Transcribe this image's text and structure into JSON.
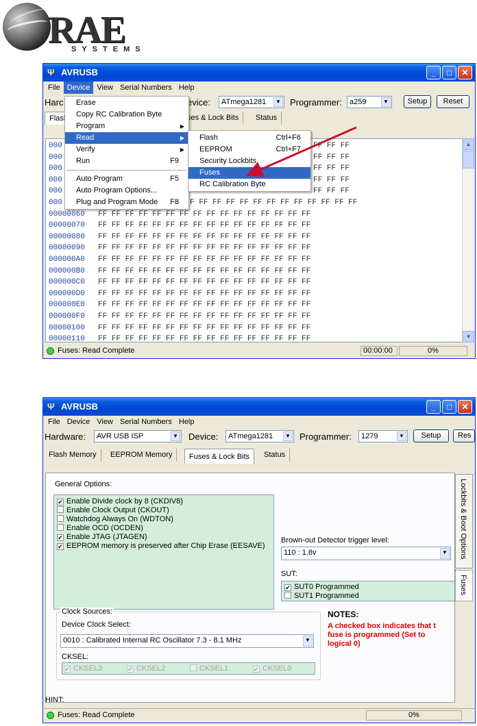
{
  "logo": {
    "text": "RAE",
    "sub": "SYSTEMS"
  },
  "window1": {
    "title": "AVRUSB",
    "menu": [
      "File",
      "Device",
      "View",
      "Serial Numbers",
      "Help"
    ],
    "toolbar": {
      "hardware_label": "Harc",
      "device_label": "evice:",
      "device_value": "ATmega1281",
      "programmer_label": "Programmer:",
      "programmer_value": "a259",
      "setup": "Setup",
      "reset": "Reset"
    },
    "tabs": [
      "Flasl",
      "ses & Lock Bits",
      "Status"
    ],
    "hex_rows_partial": [
      {
        "addr": "000",
        "bytes": "FF FF FF"
      },
      {
        "addr": "000",
        "bytes": "FF FF FF"
      },
      {
        "addr": "000",
        "bytes": "FF FF FF"
      },
      {
        "addr": "000",
        "bytes": "FF FF FF"
      },
      {
        "addr": "000",
        "bytes": "FF FF FF"
      },
      {
        "addr": "000",
        "bytes": "FF FF FF FF FF FF FF FF FF FF FF FF FF FF FF FF"
      },
      {
        "addr": "00000060",
        "bytes": "FF FF FF FF FF FF FF FF FF FF FF FF FF FF FF FF"
      }
    ],
    "hex_rows": [
      {
        "addr": "00000070",
        "bytes": "FF FF FF FF FF FF FF FF FF FF FF FF FF FF FF FF"
      },
      {
        "addr": "00000080",
        "bytes": "FF FF FF FF FF FF FF FF FF FF FF FF FF FF FF FF"
      },
      {
        "addr": "00000090",
        "bytes": "FF FF FF FF FF FF FF FF FF FF FF FF FF FF FF FF"
      },
      {
        "addr": "000000A0",
        "bytes": "FF FF FF FF FF FF FF FF FF FF FF FF FF FF FF FF"
      },
      {
        "addr": "000000B0",
        "bytes": "FF FF FF FF FF FF FF FF FF FF FF FF FF FF FF FF"
      },
      {
        "addr": "000000C0",
        "bytes": "FF FF FF FF FF FF FF FF FF FF FF FF FF FF FF FF"
      },
      {
        "addr": "000000D0",
        "bytes": "FF FF FF FF FF FF FF FF FF FF FF FF FF FF FF FF"
      },
      {
        "addr": "000000E0",
        "bytes": "FF FF FF FF FF FF FF FF FF FF FF FF FF FF FF FF"
      },
      {
        "addr": "000000F0",
        "bytes": "FF FF FF FF FF FF FF FF FF FF FF FF FF FF FF FF"
      },
      {
        "addr": "00000100",
        "bytes": "FF FF FF FF FF FF FF FF FF FF FF FF FF FF FF FF"
      },
      {
        "addr": "00000110",
        "bytes": "FF FF FF FF FF FF FF FF FF FF FF FF FF FF FF FF"
      }
    ],
    "device_menu": [
      {
        "label": "Erase",
        "shortcut": ""
      },
      {
        "label": "Copy RC Calibration Byte",
        "shortcut": ""
      },
      {
        "label": "Program",
        "shortcut": ""
      },
      {
        "label": "Read",
        "shortcut": ""
      },
      {
        "label": "Verify",
        "shortcut": ""
      },
      {
        "label": "Run",
        "shortcut": "F9"
      },
      {
        "label": "Auto Program",
        "shortcut": "F5"
      },
      {
        "label": "Auto Program Options...",
        "shortcut": ""
      },
      {
        "label": "Plug and Program Mode",
        "shortcut": "F8"
      }
    ],
    "read_submenu": [
      {
        "label": "Flash",
        "shortcut": "Ctrl+F6"
      },
      {
        "label": "EEPROM",
        "shortcut": "Ctrl+F7"
      },
      {
        "label": "Security Lockbits",
        "shortcut": ""
      },
      {
        "label": "Fuses",
        "shortcut": ""
      },
      {
        "label": "RC Calibration Byte",
        "shortcut": ""
      }
    ],
    "status": {
      "text": "Fuses: Read Complete",
      "time": "00:00:00",
      "percent": "0%"
    }
  },
  "window2": {
    "title": "AVRUSB",
    "menu": [
      "File",
      "Device",
      "View",
      "Serial Numbers",
      "Help"
    ],
    "toolbar": {
      "hardware_label": "Hardware:",
      "hardware_value": "AVR USB ISP",
      "device_label": "Device:",
      "device_value": "ATmega1281",
      "programmer_label": "Programmer:",
      "programmer_value": "1279",
      "setup": "Setup",
      "reset": "Res"
    },
    "tabs": [
      "Flash Memory",
      "EEPROM Memory",
      "Fuses & Lock Bits",
      "Status"
    ],
    "general_options_label": "General Options:",
    "general_options": [
      {
        "label": "Enable Divide clock by 8 (CKDIV8)",
        "checked": true
      },
      {
        "label": "Enable Clock Output (CKOUT)",
        "checked": false
      },
      {
        "label": "Watchdog Always On (WDTON)",
        "checked": false
      },
      {
        "label": "Enable OCD (OCDEN)",
        "checked": false
      },
      {
        "label": "Enable JTAG (JTAGEN)",
        "checked": true
      },
      {
        "label": "EEPROM memory is preserved after Chip Erase (EESAVE)",
        "checked": true
      }
    ],
    "bod_label": "Brown-out Detector trigger level:",
    "bod_value": "110 : 1.8v",
    "sut_label": "SUT:",
    "sut_options": [
      {
        "label": "SUT0 Programmed",
        "checked": true
      },
      {
        "label": "SUT1 Programmed",
        "checked": false
      }
    ],
    "side_tabs": [
      "Lockbits & Boot Options",
      "Fuses"
    ],
    "clock": {
      "legend": "Clock Sources:",
      "select_label": "Device Clock Select:",
      "select_value": "0010 : Calibrated Internal RC Oscillator 7.3 - 8.1 MHz",
      "cksel_label": "CKSEL:",
      "cksel": [
        {
          "label": "CKSEL3",
          "checked": true
        },
        {
          "label": "CKSEL2",
          "checked": true
        },
        {
          "label": "CKSEL1",
          "checked": false
        },
        {
          "label": "CKSEL0",
          "checked": true
        }
      ]
    },
    "notes": {
      "title": "NOTES:",
      "lines": [
        "A checked box indicates that t",
        "fuse is programmed (Set to",
        "logical 0)"
      ]
    },
    "hint": "HINT:",
    "status": {
      "text": "Fuses: Read Complete",
      "percent": "0%"
    }
  },
  "colors": {
    "titlebar": "#0a5fe0",
    "menu_highlight": "#316ac5",
    "listbox": "#d4eedd",
    "notes": "#e00000",
    "arrow": "#c8102e"
  }
}
